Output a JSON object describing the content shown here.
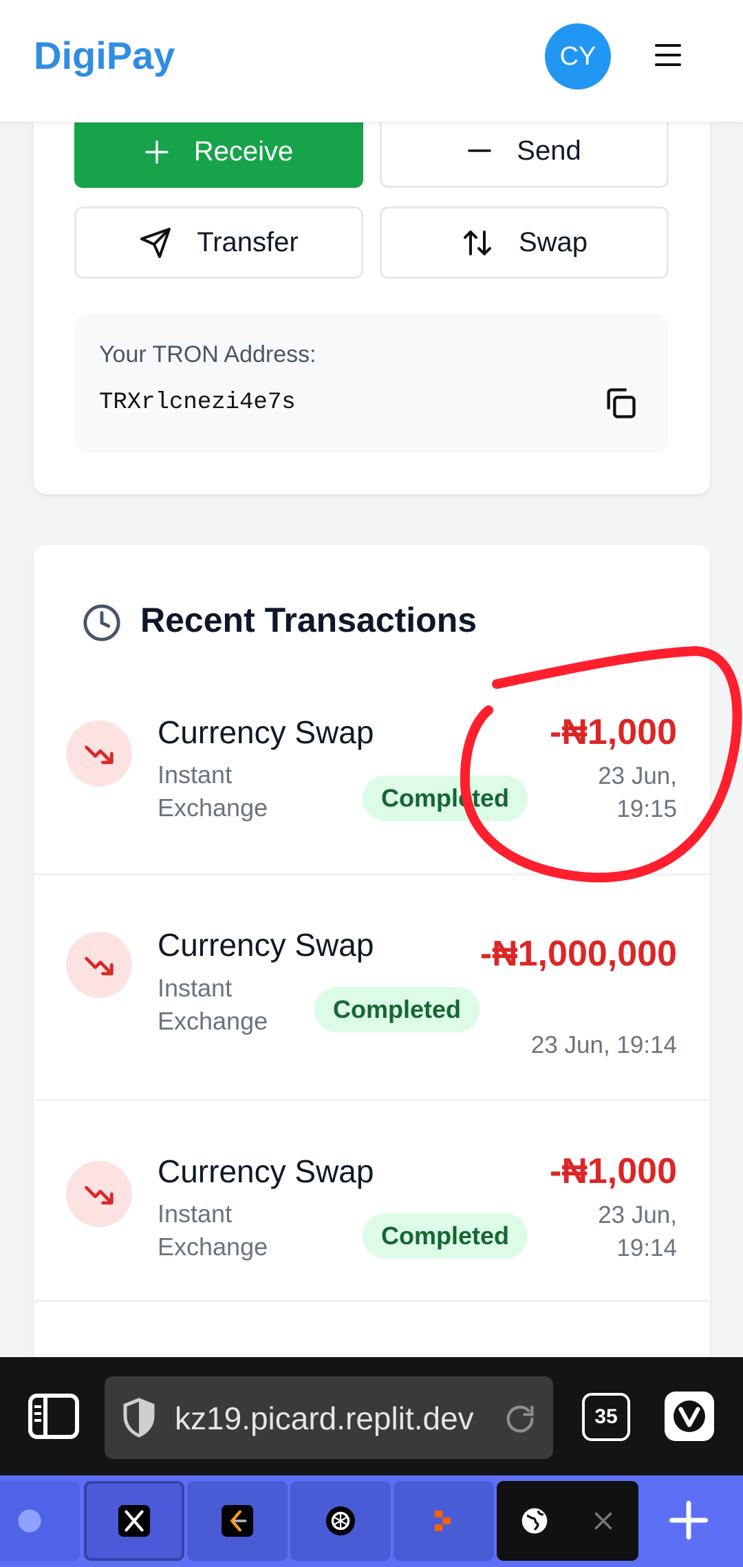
{
  "header": {
    "brand": "DigiPay",
    "avatar_initials": "CY"
  },
  "actions": {
    "receive": "Receive",
    "send": "Send",
    "transfer": "Transfer",
    "swap": "Swap"
  },
  "address": {
    "label": "Your TRON Address:",
    "value": "TRXrlcnezi4e7s"
  },
  "transactions": {
    "title": "Recent Transactions",
    "items": [
      {
        "name": "Currency Swap",
        "desc": "Instant Exchange",
        "status": "Completed",
        "amount": "-₦1,000",
        "date": "23 Jun, 19:15"
      },
      {
        "name": "Currency Swap",
        "desc": "Instant Exchange",
        "status": "Completed",
        "amount": "-₦1,000,000",
        "date": "23 Jun, 19:14"
      },
      {
        "name": "Currency Swap",
        "desc": "Instant Exchange",
        "status": "Completed",
        "amount": "-₦1,000",
        "date": "23 Jun, 19:14"
      }
    ]
  },
  "browser": {
    "url": "kz19.picard.replit.dev",
    "tab_count": "35"
  },
  "colors": {
    "brand": "#2f8de4",
    "receive_green": "#16a34a",
    "debit_red": "#dc2626",
    "annotation_red": "#ff1f2d",
    "tab_strip": "#5d6ff5"
  }
}
